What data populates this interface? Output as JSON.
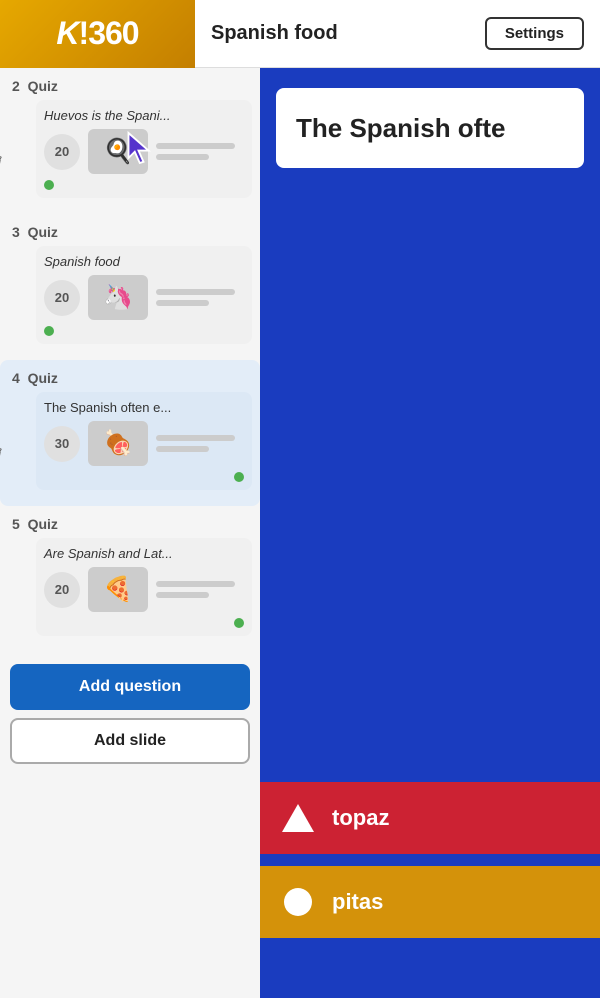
{
  "header": {
    "logo": "K!360",
    "title": "Spanish food",
    "settings_label": "Settings"
  },
  "sidebar": {
    "sections": [
      {
        "number": "2",
        "type": "Quiz",
        "card": {
          "title": "Huevos is the Spani...",
          "points": "20",
          "thumb_emoji": "🍳",
          "active": false,
          "has_cursor": true
        }
      },
      {
        "number": "3",
        "type": "Quiz",
        "card": {
          "title": "Spanish food",
          "points": "20",
          "thumb_emoji": "🦄",
          "active": false,
          "has_cursor": false
        }
      },
      {
        "number": "4",
        "type": "Quiz",
        "card": {
          "title": "The Spanish often e...",
          "points": "30",
          "thumb_emoji": "🍖",
          "active": true,
          "has_cursor": false
        }
      },
      {
        "number": "5",
        "type": "Quiz",
        "card": {
          "title": "Are Spanish and Lat...",
          "points": "20",
          "thumb_emoji": "🍕",
          "active": false,
          "has_cursor": false
        }
      }
    ],
    "add_question_label": "Add question",
    "add_slide_label": "Add slide"
  },
  "content": {
    "question_text": "The Spanish ofte",
    "answers": [
      {
        "label": "topaz",
        "shape": "triangle",
        "color": "red"
      },
      {
        "label": "pitas",
        "shape": "circle",
        "color": "gold"
      }
    ]
  }
}
